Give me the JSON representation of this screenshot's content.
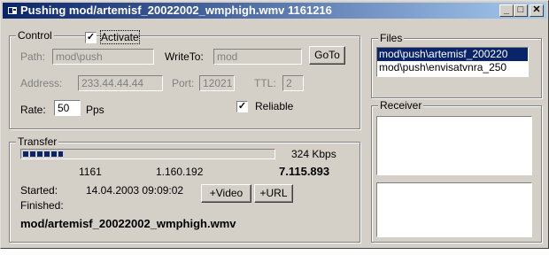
{
  "window": {
    "title": "Pushing mod/artemisf_20022002_wmphigh.wmv 1161216",
    "minimize": "_",
    "maximize": "□",
    "close": "✕"
  },
  "control": {
    "legend": "Control",
    "activate_label": "Activate",
    "activate_checked": true,
    "path_label": "Path:",
    "path_value": "mod\\push",
    "writeto_label": "WriteTo:",
    "writeto_value": "mod",
    "goto_label": "GoTo",
    "address_label": "Address:",
    "address_value": "233.44.44.44",
    "port_label": "Port:",
    "port_value": "12021",
    "ttl_label": "TTL:",
    "ttl_value": "2",
    "rate_label": "Rate:",
    "rate_value": "50",
    "rate_unit": "Pps",
    "reliable_label": "Reliable",
    "reliable_checked": true
  },
  "transfer": {
    "legend": "Transfer",
    "progress": 0.16,
    "speed": "324 Kbps",
    "stat1": "1161",
    "stat2": "1.160.192",
    "stat3": "7.115.893",
    "started_label": "Started:",
    "started_value": "14.04.2003 09:09:02",
    "video_button": "+Video",
    "url_button": "+URL",
    "finished_label": "Finished:",
    "filename": "mod/artemisf_20022002_wmphigh.wmv"
  },
  "files": {
    "legend": "Files",
    "items": [
      "mod\\push\\artemisf_200220",
      "mod\\push\\envisatvnra_250"
    ],
    "selected_index": 0
  },
  "receiver": {
    "legend": "Receiver"
  },
  "icons": {
    "title": "window-app-icon",
    "check": "checkmark-icon"
  }
}
